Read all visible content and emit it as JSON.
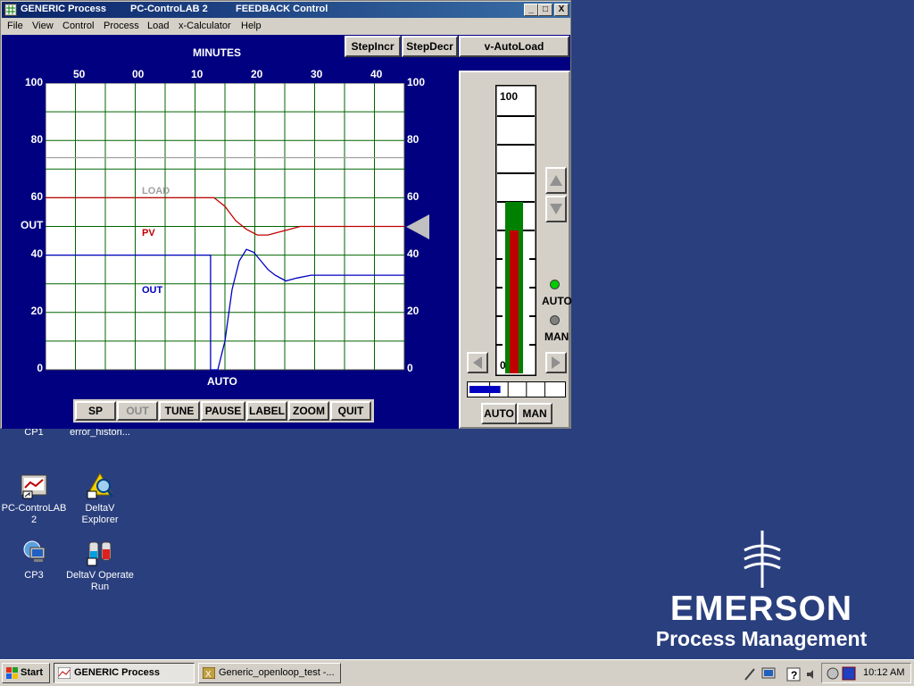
{
  "window": {
    "title_left": "GENERIC Process",
    "title_mid": "PC-ControLAB 2",
    "title_right": "FEEDBACK Control",
    "btn_min": "_",
    "btn_max": "□",
    "btn_close": "X"
  },
  "menu": [
    {
      "label": "File"
    },
    {
      "label": "View"
    },
    {
      "label": "Control"
    },
    {
      "label": "Process"
    },
    {
      "label": "Load"
    },
    {
      "label": "x-Calculator"
    },
    {
      "label": "Help"
    }
  ],
  "toolbar": {
    "step_incr": "StepIncr",
    "step_decr": "StepDecr",
    "autoload": "v-AutoLoad"
  },
  "trend": {
    "x_title": "MINUTES",
    "x_ticks": [
      "50",
      "00",
      "10",
      "20",
      "30",
      "40"
    ],
    "y_ticks_left": [
      "100",
      "80",
      "60",
      "40",
      "20",
      "0"
    ],
    "y_ticks_right": [
      "100",
      "80",
      "60",
      "40",
      "20",
      "0"
    ],
    "out_label": "OUT",
    "mode_label": "AUTO",
    "load_tag": "LOAD",
    "pv_tag": "PV",
    "out_tag": "OUT",
    "colors": {
      "load": "#a0a0a0",
      "pv": "#c00000",
      "out": "#0000c0",
      "grid": "#006400"
    }
  },
  "chart_data": {
    "type": "line",
    "xlabel": "MINUTES",
    "ylabel": "",
    "ylim": [
      0,
      100
    ],
    "series": [
      {
        "name": "LOAD",
        "points": [
          [
            0,
            74
          ],
          [
            100,
            74
          ]
        ]
      },
      {
        "name": "PV",
        "points": [
          [
            0,
            60
          ],
          [
            47,
            60
          ],
          [
            50,
            57
          ],
          [
            53,
            52
          ],
          [
            56,
            49
          ],
          [
            59,
            47
          ],
          [
            62,
            47
          ],
          [
            65,
            48
          ],
          [
            68,
            49
          ],
          [
            71,
            50
          ],
          [
            100,
            50
          ]
        ]
      },
      {
        "name": "OUT",
        "points": [
          [
            0,
            40
          ],
          [
            46,
            40
          ],
          [
            46,
            0
          ],
          [
            48,
            0
          ],
          [
            50,
            10
          ],
          [
            52,
            28
          ],
          [
            54,
            38
          ],
          [
            56,
            42
          ],
          [
            58,
            41
          ],
          [
            60,
            38
          ],
          [
            62,
            35
          ],
          [
            64,
            33
          ],
          [
            67,
            31
          ],
          [
            70,
            32
          ],
          [
            74,
            33
          ],
          [
            80,
            33
          ],
          [
            100,
            33
          ]
        ]
      }
    ]
  },
  "bottom_buttons": {
    "sp": "SP",
    "out": "OUT",
    "tune": "TUNE",
    "pause": "PAUSE",
    "label": "LABEL",
    "zoom": "ZOOM",
    "quit": "QUIT"
  },
  "faceplate": {
    "bar_top": "100",
    "bar_bottom": "0",
    "auto_label": "AUTO",
    "man_label": "MAN",
    "btn_auto": "AUTO",
    "btn_man": "MAN",
    "sp_value": 60,
    "pv_value": 50,
    "out_value": 33,
    "colors": {
      "pv": "#c00000",
      "sp": "#008000",
      "auto_lamp": "#00cc00",
      "man_lamp": "#808080"
    }
  },
  "desktop": {
    "icons": [
      {
        "label": "CP1"
      },
      {
        "label": "error_histori..."
      },
      {
        "label": "PC-ControLAB 2"
      },
      {
        "label": "DeltaV Explorer"
      },
      {
        "label": "CP3"
      },
      {
        "label": "DeltaV Operate Run"
      }
    ],
    "logo_brand": "EMERSON",
    "logo_sub": "Process Management"
  },
  "taskbar": {
    "start": "Start",
    "tasks": [
      {
        "label": "GENERIC Process"
      },
      {
        "label": "Generic_openloop_test -..."
      }
    ],
    "clock": "10:12 AM"
  }
}
